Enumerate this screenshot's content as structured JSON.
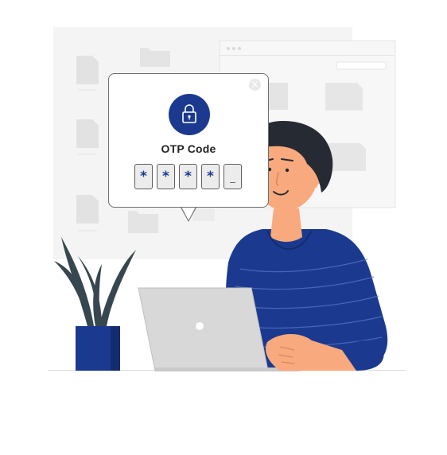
{
  "otp": {
    "title": "OTP Code",
    "close_icon": "close-icon",
    "lock_icon": "lock-icon",
    "digits": [
      "*",
      "*",
      "*",
      "*",
      "_"
    ]
  },
  "colors": {
    "brand_blue": "#1b3a8f",
    "skin": "#f9a97e",
    "hair": "#262b33",
    "laptop": "#d8d8d8",
    "plant_leaf": "#37474f"
  }
}
